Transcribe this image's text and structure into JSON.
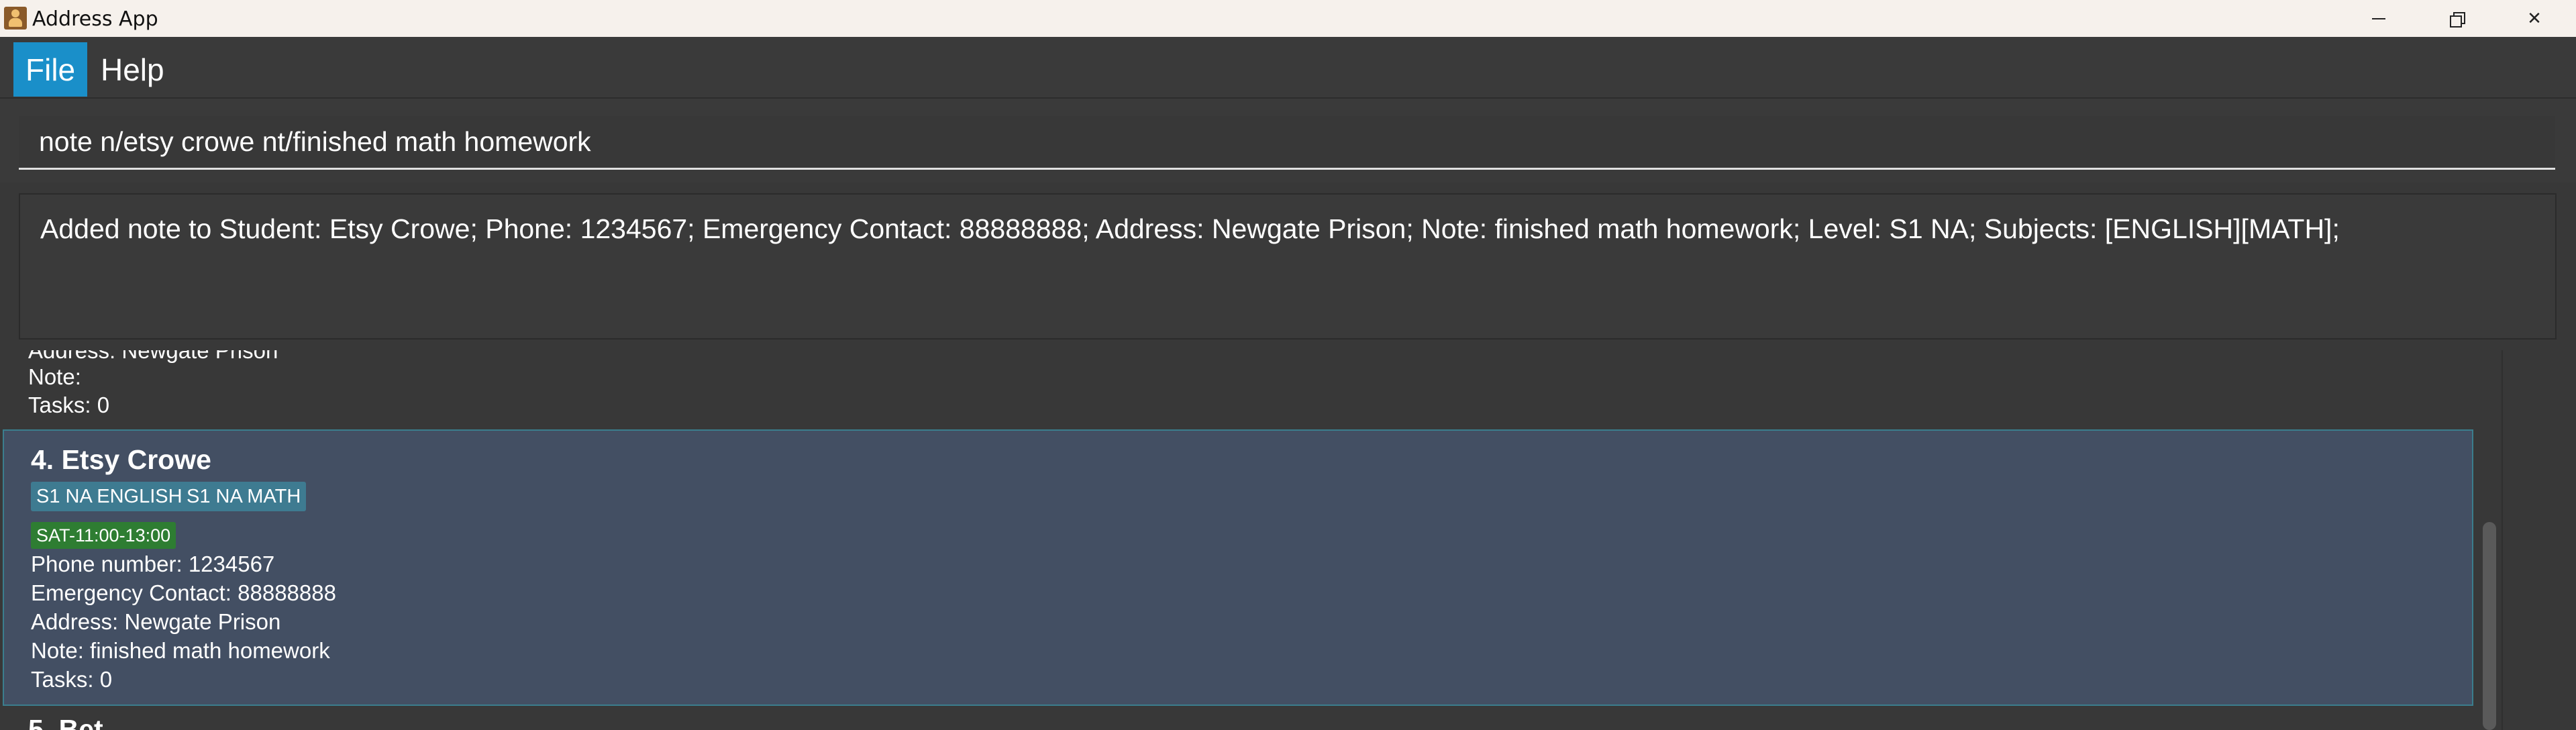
{
  "window": {
    "title": "Address App",
    "icon": "person-icon",
    "controls": {
      "minimize": "minimize-icon",
      "maximize": "restore-icon",
      "close": "✕"
    }
  },
  "menu": {
    "items": [
      {
        "label": "File"
      },
      {
        "label": "Help"
      }
    ]
  },
  "command": {
    "value": "note n/etsy crowe nt/finished math homework"
  },
  "result": {
    "text": "Added note to Student: Etsy Crowe; Phone: 1234567; Emergency Contact: 88888888; Address: Newgate Prison; Note: finished math homework; Level: S1 NA; Subjects: [ENGLISH][MATH];"
  },
  "list": {
    "previous_card": {
      "address_partial": "Address: Newgate Prison",
      "note": "Note:",
      "tasks": "Tasks: 0"
    },
    "selected_card": {
      "name": "4. Etsy Crowe",
      "tags": [
        "S1 NA ENGLISH",
        "S1 NA MATH"
      ],
      "time_tag": "SAT-11:00-13:00",
      "phone": "Phone number: 1234567",
      "emergency": "Emergency Contact: 88888888",
      "address": "Address: Newgate Prison",
      "note": "Note: finished math homework",
      "tasks": "Tasks: 0"
    },
    "next_card": {
      "name_partial": "5. Bet"
    }
  },
  "colors": {
    "accent": "#1a8fc9",
    "card_selected": "#434f63",
    "tag": "#3e7b91",
    "time_tag": "#2e7d32"
  }
}
